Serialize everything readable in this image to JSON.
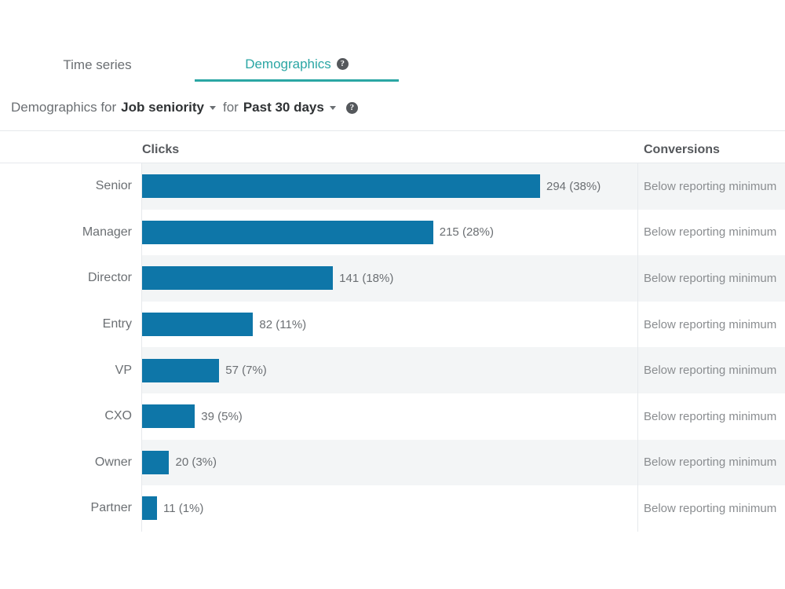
{
  "tabs": [
    {
      "label": "Time series",
      "active": false,
      "help": false
    },
    {
      "label": "Demographics",
      "active": true,
      "help": true,
      "help_glyph": "?"
    }
  ],
  "filter": {
    "prefix": "Demographics for",
    "dimension": "Job seniority",
    "connector": "for",
    "period": "Past 30 days",
    "help_glyph": "?"
  },
  "table": {
    "columns": [
      {
        "key": "label",
        "header": ""
      },
      {
        "key": "clicks",
        "header": "Clicks"
      },
      {
        "key": "conversions",
        "header": "Conversions"
      }
    ],
    "rows": [
      {
        "label": "Senior",
        "clicks": 294,
        "percent": "38%",
        "clicks_text": "294 (38%)",
        "conversions": "Below reporting minimum"
      },
      {
        "label": "Manager",
        "clicks": 215,
        "percent": "28%",
        "clicks_text": "215 (28%)",
        "conversions": "Below reporting minimum"
      },
      {
        "label": "Director",
        "clicks": 141,
        "percent": "18%",
        "clicks_text": "141 (18%)",
        "conversions": "Below reporting minimum"
      },
      {
        "label": "Entry",
        "clicks": 82,
        "percent": "11%",
        "clicks_text": "82 (11%)",
        "conversions": "Below reporting minimum"
      },
      {
        "label": "VP",
        "clicks": 57,
        "percent": "7%",
        "clicks_text": "57 (7%)",
        "conversions": "Below reporting minimum"
      },
      {
        "label": "CXO",
        "clicks": 39,
        "percent": "5%",
        "clicks_text": "39 (5%)",
        "conversions": "Below reporting minimum"
      },
      {
        "label": "Owner",
        "clicks": 20,
        "percent": "3%",
        "clicks_text": "20 (3%)",
        "conversions": "Below reporting minimum"
      },
      {
        "label": "Partner",
        "clicks": 11,
        "percent": "1%",
        "clicks_text": "11 (1%)",
        "conversions": "Below reporting minimum"
      }
    ]
  },
  "colors": {
    "bar": "#0e76a8",
    "active_tab": "#2ba6a4",
    "stripe": "#f3f5f6",
    "text": "#6b6f73",
    "divider": "#e6e9ec"
  },
  "chart_data": {
    "type": "bar",
    "orientation": "horizontal",
    "title": "Demographics for Job seniority for Past 30 days",
    "xlabel": "Clicks",
    "ylabel": "",
    "categories": [
      "Senior",
      "Manager",
      "Director",
      "Entry",
      "VP",
      "CXO",
      "Owner",
      "Partner"
    ],
    "values": [
      294,
      215,
      141,
      82,
      57,
      39,
      20,
      11
    ],
    "percents": [
      "38%",
      "28%",
      "18%",
      "11%",
      "7%",
      "5%",
      "3%",
      "1%"
    ],
    "data_labels": [
      "294 (38%)",
      "215 (28%)",
      "141 (18%)",
      "82 (11%)",
      "57 (7%)",
      "39 (5%)",
      "20 (3%)",
      "11 (1%)"
    ],
    "xlim": [
      0,
      294
    ],
    "grid": false,
    "legend": "none",
    "series": [
      {
        "name": "Clicks",
        "values": [
          294,
          215,
          141,
          82,
          57,
          39,
          20,
          11
        ]
      }
    ],
    "annotations": [
      "Conversions: Below reporting minimum for all categories"
    ]
  }
}
